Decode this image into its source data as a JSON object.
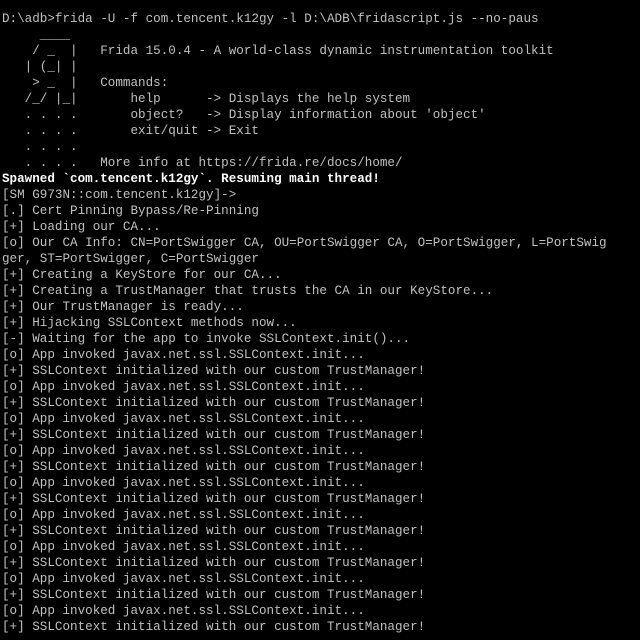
{
  "terminal": {
    "colors": {
      "background": "#000000",
      "text": "#c0c0c0",
      "bright_text": "#ffffff"
    },
    "lines": [
      {
        "text": "D:\\adb>frida -U -f com.tencent.k12gy -l D:\\ADB\\fridascript.js --no-paus",
        "style": "normal"
      },
      {
        "text": "     ____",
        "style": "normal"
      },
      {
        "text": "    / _  |   Frida 15.0.4 - A world-class dynamic instrumentation toolkit",
        "style": "normal"
      },
      {
        "text": "   | (_| |",
        "style": "normal"
      },
      {
        "text": "    > _  |   Commands:",
        "style": "normal"
      },
      {
        "text": "   /_/ |_|       help      -> Displays the help system",
        "style": "normal"
      },
      {
        "text": "   . . . .       object?   -> Display information about 'object'",
        "style": "normal"
      },
      {
        "text": "   . . . .       exit/quit -> Exit",
        "style": "normal"
      },
      {
        "text": "   . . . .",
        "style": "normal"
      },
      {
        "text": "   . . . .   More info at https://frida.re/docs/home/",
        "style": "normal"
      },
      {
        "text": "Spawned `com.tencent.k12gy`. Resuming main thread!",
        "style": "bright"
      },
      {
        "text": "[SM G973N::com.tencent.k12gy]->",
        "style": "normal"
      },
      {
        "text": "[.] Cert Pinning Bypass/Re-Pinning",
        "style": "normal"
      },
      {
        "text": "[+] Loading our CA...",
        "style": "normal"
      },
      {
        "text": "[o] Our CA Info: CN=PortSwigger CA, OU=PortSwigger CA, O=PortSwigger, L=PortSwig",
        "style": "normal"
      },
      {
        "text": "ger, ST=PortSwigger, C=PortSwigger",
        "style": "normal"
      },
      {
        "text": "[+] Creating a KeyStore for our CA...",
        "style": "normal"
      },
      {
        "text": "[+] Creating a TrustManager that trusts the CA in our KeyStore...",
        "style": "normal"
      },
      {
        "text": "[+] Our TrustManager is ready...",
        "style": "normal"
      },
      {
        "text": "[+] Hijacking SSLContext methods now...",
        "style": "normal"
      },
      {
        "text": "[-] Waiting for the app to invoke SSLContext.init()...",
        "style": "normal"
      },
      {
        "text": "[o] App invoked javax.net.ssl.SSLContext.init...",
        "style": "normal"
      },
      {
        "text": "[+] SSLContext initialized with our custom TrustManager!",
        "style": "normal"
      },
      {
        "text": "[o] App invoked javax.net.ssl.SSLContext.init...",
        "style": "normal"
      },
      {
        "text": "[+] SSLContext initialized with our custom TrustManager!",
        "style": "normal"
      },
      {
        "text": "[o] App invoked javax.net.ssl.SSLContext.init...",
        "style": "normal"
      },
      {
        "text": "[+] SSLContext initialized with our custom TrustManager!",
        "style": "normal"
      },
      {
        "text": "[o] App invoked javax.net.ssl.SSLContext.init...",
        "style": "normal"
      },
      {
        "text": "[+] SSLContext initialized with our custom TrustManager!",
        "style": "normal"
      },
      {
        "text": "[o] App invoked javax.net.ssl.SSLContext.init...",
        "style": "normal"
      },
      {
        "text": "[+] SSLContext initialized with our custom TrustManager!",
        "style": "normal"
      },
      {
        "text": "[o] App invoked javax.net.ssl.SSLContext.init...",
        "style": "normal"
      },
      {
        "text": "[+] SSLContext initialized with our custom TrustManager!",
        "style": "normal"
      },
      {
        "text": "[o] App invoked javax.net.ssl.SSLContext.init...",
        "style": "normal"
      },
      {
        "text": "[+] SSLContext initialized with our custom TrustManager!",
        "style": "normal"
      },
      {
        "text": "[o] App invoked javax.net.ssl.SSLContext.init...",
        "style": "normal"
      },
      {
        "text": "[+] SSLContext initialized with our custom TrustManager!",
        "style": "normal"
      },
      {
        "text": "[o] App invoked javax.net.ssl.SSLContext.init...",
        "style": "normal"
      },
      {
        "text": "[+] SSLContext initialized with our custom TrustManager!",
        "style": "normal"
      }
    ]
  }
}
